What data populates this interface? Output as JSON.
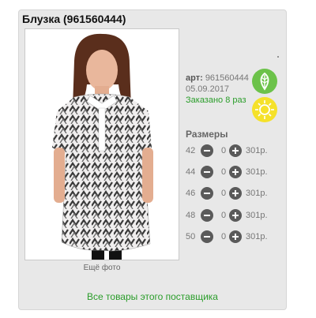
{
  "product": {
    "title": "Блузка (961560444)",
    "art_label": "арт:",
    "art_value": "961560444",
    "date": "05.09.2017",
    "ordered": "Заказано 8 раз",
    "more_photo": "Ещё фото"
  },
  "badges": {
    "leaf": "leaf-icon",
    "sun": "sun-icon"
  },
  "sizes": {
    "title": "Размеры",
    "rows": [
      {
        "size": "42",
        "qty": "0",
        "price": "301р."
      },
      {
        "size": "44",
        "qty": "0",
        "price": "301р."
      },
      {
        "size": "46",
        "qty": "0",
        "price": "301р."
      },
      {
        "size": "48",
        "qty": "0",
        "price": "301р."
      },
      {
        "size": "50",
        "qty": "0",
        "price": "301р."
      }
    ]
  },
  "footer": {
    "supplier_link": "Все товары этого поставщика"
  },
  "colors": {
    "accent": "#2a9d2a",
    "leaf": "#6cc24a",
    "sun": "#f5e12a"
  }
}
